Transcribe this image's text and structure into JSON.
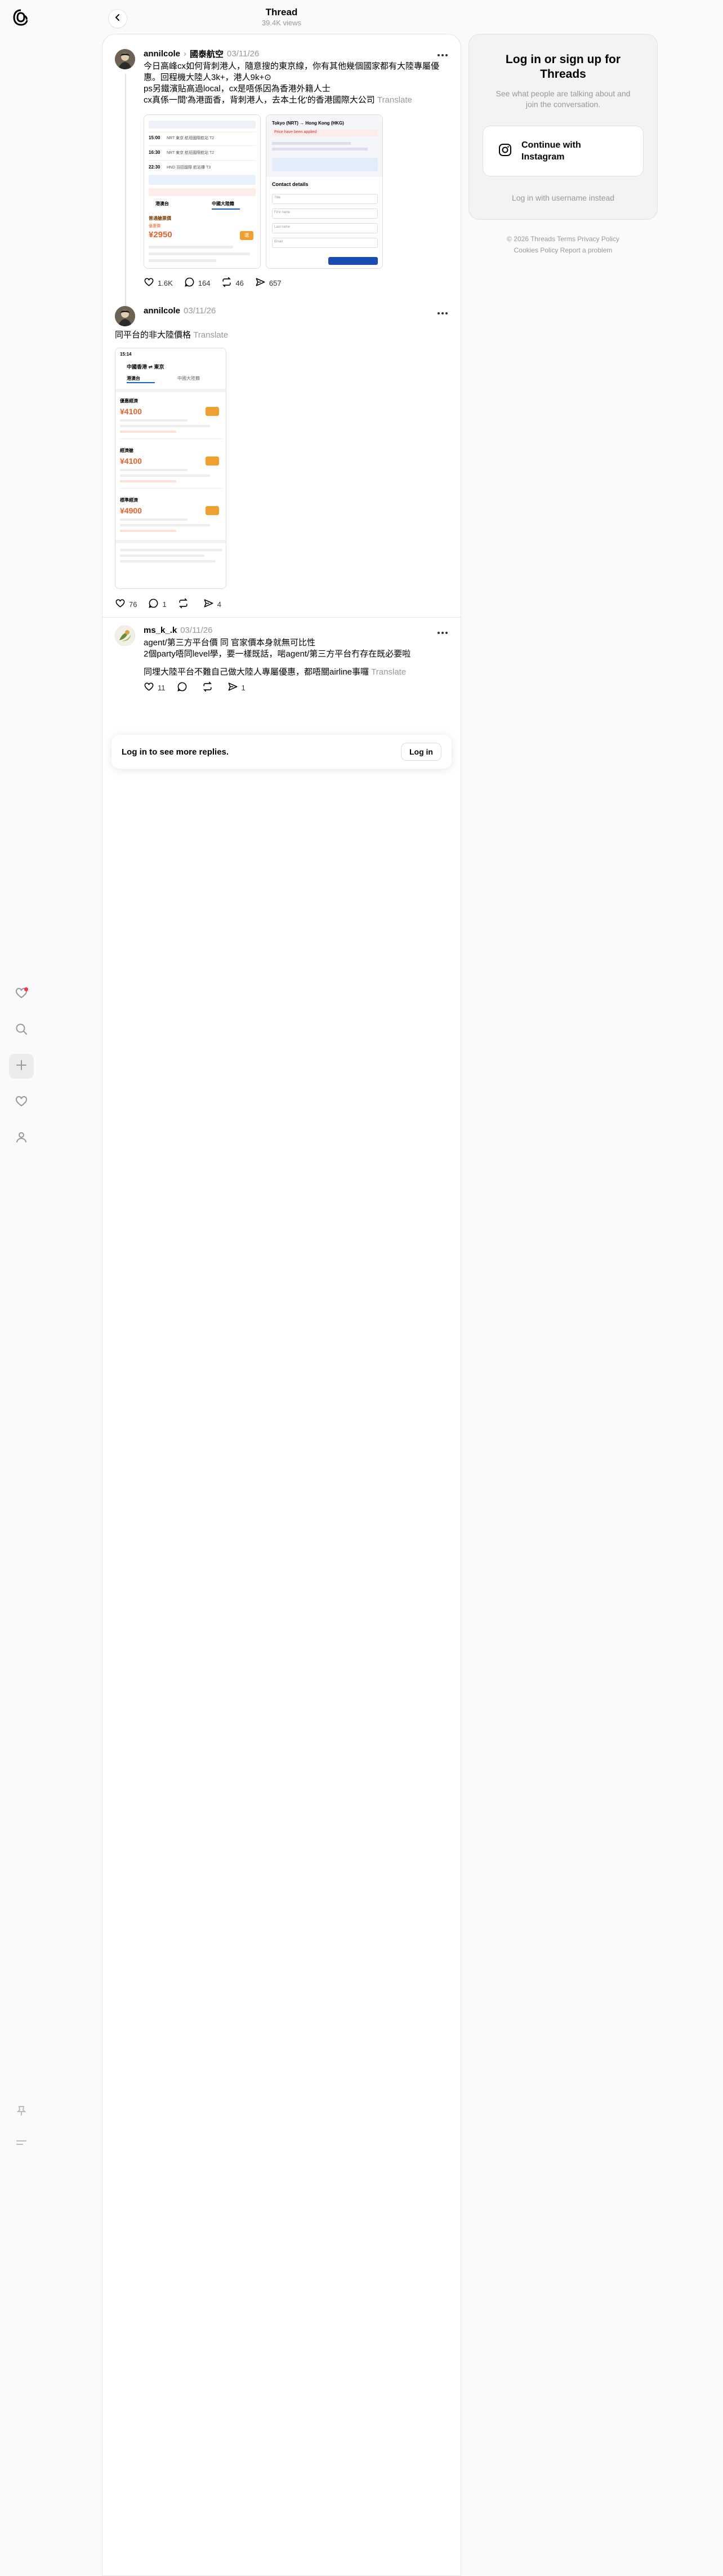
{
  "header": {
    "title": "Thread",
    "views": "39.4K views"
  },
  "nav": {
    "items": [
      {
        "name": "activity",
        "icon": "heart-dot-icon"
      },
      {
        "name": "search",
        "icon": "search-icon"
      },
      {
        "name": "create",
        "icon": "plus-icon"
      },
      {
        "name": "likes",
        "icon": "heart-icon"
      },
      {
        "name": "profile",
        "icon": "person-icon"
      }
    ],
    "bottom": [
      {
        "name": "pin",
        "icon": "pin-icon"
      },
      {
        "name": "menu",
        "icon": "menu-icon"
      }
    ]
  },
  "posts": [
    {
      "username": "annilcole",
      "tag": "國泰航空",
      "time": "03/11/26",
      "lines": [
        "今日高峰cx如何背刺港人，隨意搜的東京線，你有其他幾個國家都有大陸專屬優",
        "惠。回程機大陸人3k+，港人9k+⊙",
        "ps另鐵濱貼高過local，cx是唔係因為香港外籍人士",
        "cx真係一間'為港面香，背刺港人，去本土化'的香港國際大公司"
      ],
      "translate": "Translate",
      "likes": "1.6K",
      "replies": "164",
      "reposts": "46",
      "shares": "657",
      "screenshots": {
        "left": {
          "rows": [
            {
              "time": "15:00",
              "flight": "NRT 東京 航班國際航站 T2"
            },
            {
              "time": "16:30",
              "flight": "NRT 東京 航班國際航站 T2"
            },
            {
              "time": "22:30",
              "flight": "HND 羽田國際 航站樓 T3"
            }
          ],
          "tab_a": "港澳台",
          "tab_b": "中國大陸籍",
          "promo": "優惠價",
          "price": "¥2950",
          "book": "選",
          "fare": "普通艙票價"
        },
        "right": {
          "route": "Tokyo (NRT) → Hong Kong (HKG)",
          "alert": "Price have been applied",
          "section": "Contact details",
          "fields": [
            "Title",
            "First name",
            "Last name",
            "Email"
          ]
        }
      }
    },
    {
      "username": "annilcole",
      "time": "03/11/26",
      "lines": [
        "同平台的非大陸價格"
      ],
      "translate": "Translate",
      "likes": "76",
      "replies": "1",
      "reposts": "",
      "shares": "4",
      "screenshot": {
        "status": "15:14",
        "route": "中國香港 ⇌ 東京",
        "tab_a": "港澳台",
        "tab_b": "中國大陸籍",
        "fares": [
          {
            "label": "優惠經濟",
            "price": "¥4100"
          },
          {
            "label": "經濟艙",
            "price": "¥4100"
          },
          {
            "label": "標準經濟",
            "price": "¥4900"
          }
        ]
      }
    },
    {
      "username": "ms_k_.k",
      "time": "03/11/26",
      "lines": [
        "agent/第三方平台價 同 官家價本身就無可比性",
        "2個party唔同level學，要一樣既話，啱agent/第三方平台冇存在既必要啦",
        "同埋大陸平台不難自己做大陸人專屬優惠，都唔關airline事囉"
      ],
      "translate": "Translate",
      "likes": "11",
      "replies": "",
      "reposts": "",
      "shares": "1"
    }
  ],
  "login_bar": {
    "text": "Log in to see more replies.",
    "button": "Log in"
  },
  "panel": {
    "title": "Log in or sign up for Threads",
    "subtitle": "See what people are talking about and join the conversation.",
    "ig_button": "Continue with Instagram",
    "alt_login": "Log in with username instead"
  },
  "footer": {
    "line1": "© 2026   Threads Terms   Privacy Policy",
    "line2": "Cookies Policy   Report a problem"
  },
  "colors": {
    "accent_red": "#ff3040",
    "muted": "#999999",
    "price_orange": "#e8602a"
  }
}
